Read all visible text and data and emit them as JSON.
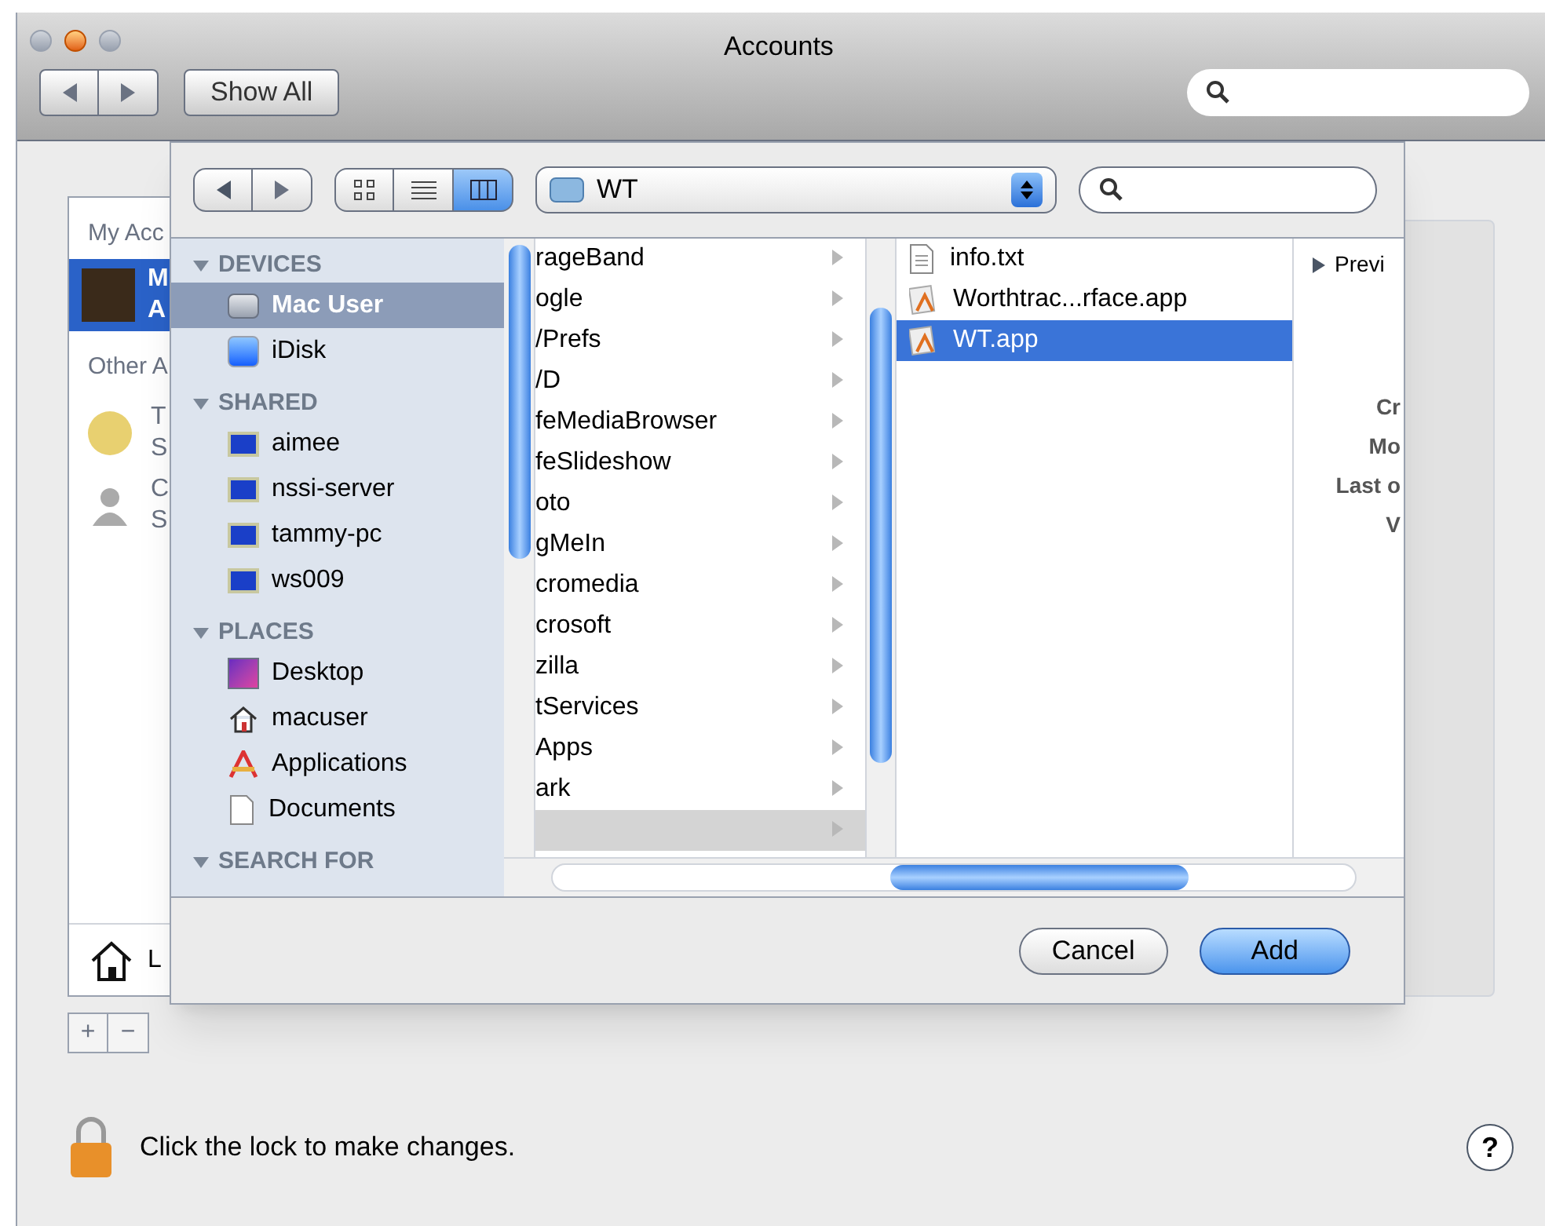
{
  "window": {
    "title": "Accounts",
    "show_all": "Show All"
  },
  "accounts": {
    "my_header": "My Acc",
    "current": {
      "name": "M",
      "kind_text": "A",
      "selected": true
    },
    "other_header": "Other A",
    "others": [
      {
        "kind": "guest",
        "name": "T",
        "sub": "S"
      },
      {
        "kind": "person",
        "name": "C",
        "sub": "S"
      }
    ],
    "login_options": "L",
    "add": "+",
    "remove": "−"
  },
  "sheet": {
    "path": "WT",
    "sidebar": [
      {
        "heading": "DEVICES",
        "items": [
          {
            "name": "Mac User",
            "kind": "drive",
            "selected": true
          },
          {
            "name": "iDisk",
            "kind": "idisk",
            "selected": false
          }
        ]
      },
      {
        "heading": "SHARED",
        "items": [
          {
            "name": "aimee",
            "kind": "monitor",
            "selected": false
          },
          {
            "name": "nssi-server",
            "kind": "monitor",
            "selected": false
          },
          {
            "name": "tammy-pc",
            "kind": "monitor",
            "selected": false
          },
          {
            "name": "ws009",
            "kind": "monitor",
            "selected": false
          }
        ]
      },
      {
        "heading": "PLACES",
        "items": [
          {
            "name": "Desktop",
            "kind": "desktop",
            "selected": false
          },
          {
            "name": "macuser",
            "kind": "home",
            "selected": false
          },
          {
            "name": "Applications",
            "kind": "apps",
            "selected": false
          },
          {
            "name": "Documents",
            "kind": "doc",
            "selected": false
          }
        ]
      },
      {
        "heading": "SEARCH FOR"
      }
    ],
    "column_1": [
      {
        "name": "rageBand",
        "selected": false
      },
      {
        "name": "ogle",
        "selected": false
      },
      {
        "name": "/Prefs",
        "selected": false
      },
      {
        "name": "/D",
        "selected": false
      },
      {
        "name": "feMediaBrowser",
        "selected": false
      },
      {
        "name": "feSlideshow",
        "selected": false
      },
      {
        "name": "oto",
        "selected": false
      },
      {
        "name": "gMeIn",
        "selected": false
      },
      {
        "name": "cromedia",
        "selected": false
      },
      {
        "name": "crosoft",
        "selected": false
      },
      {
        "name": "zilla",
        "selected": false
      },
      {
        "name": "tServices",
        "selected": false
      },
      {
        "name": "Apps",
        "selected": false
      },
      {
        "name": "ark",
        "selected": false
      },
      {
        "selected": true
      }
    ],
    "column_2": [
      {
        "name": "info.txt",
        "kind": "text",
        "selected": false
      },
      {
        "name": "Worthtrac...rface.app",
        "kind": "app",
        "selected": false
      },
      {
        "name": "WT.app",
        "kind": "app",
        "selected": true
      }
    ],
    "preview": {
      "toggle": "Previ",
      "labels": [
        "Cr",
        "Mo",
        "Last o",
        "V"
      ]
    },
    "buttons": {
      "cancel": "Cancel",
      "add": "Add"
    }
  },
  "lock_text": "Click the lock to make changes.",
  "help": "?"
}
